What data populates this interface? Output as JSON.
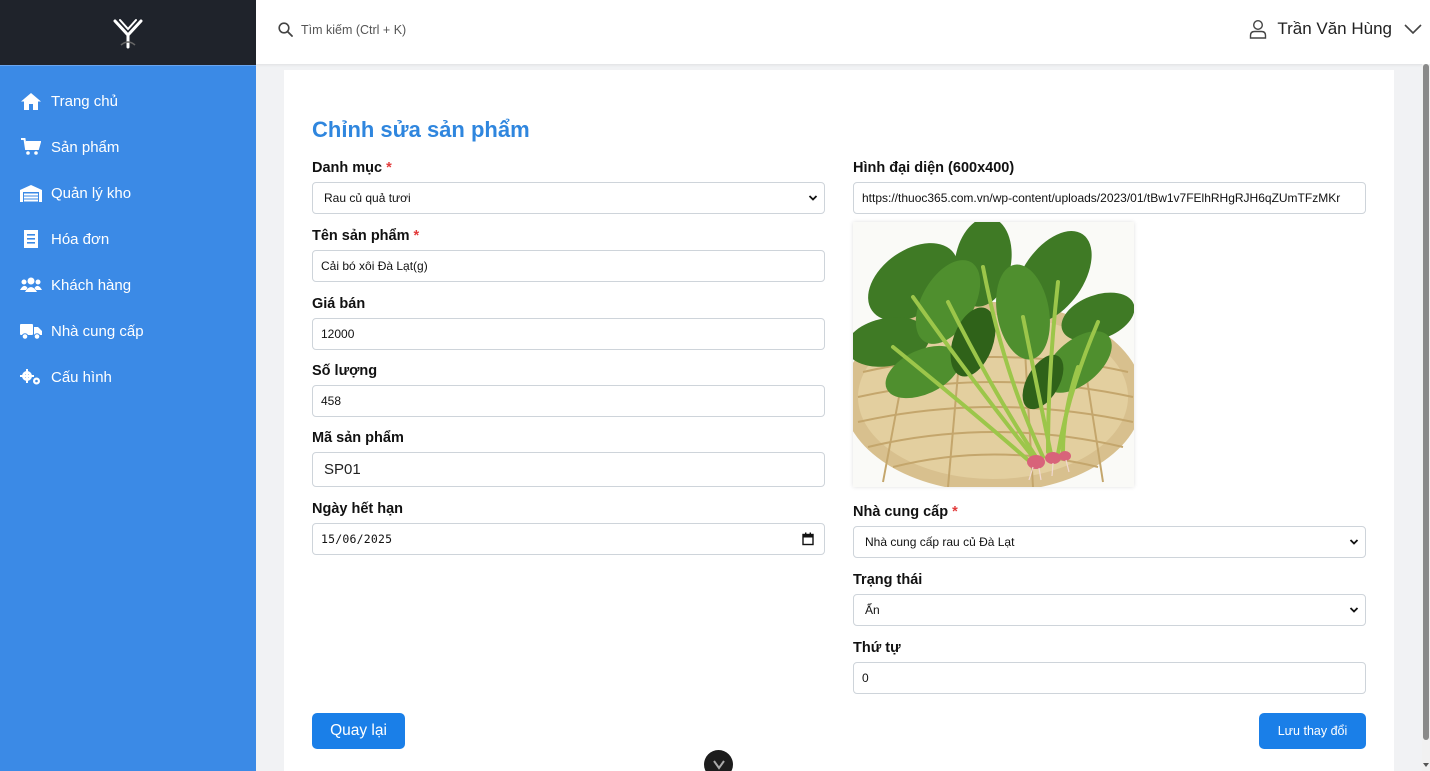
{
  "header": {
    "search_placeholder": "Tìm kiếm (Ctrl + K)",
    "user_name": "Trần Văn Hùng"
  },
  "sidebar": {
    "items": [
      {
        "label": "Trang chủ",
        "icon": "home-icon"
      },
      {
        "label": "Sản phẩm",
        "icon": "cart-icon"
      },
      {
        "label": "Quản lý kho",
        "icon": "warehouse-icon"
      },
      {
        "label": "Hóa đơn",
        "icon": "receipt-icon"
      },
      {
        "label": "Khách hàng",
        "icon": "users-icon"
      },
      {
        "label": "Nhà cung cấp",
        "icon": "truck-icon"
      },
      {
        "label": "Cấu hình",
        "icon": "gears-icon"
      }
    ]
  },
  "form": {
    "title": "Chỉnh sửa sản phẩm",
    "category": {
      "label": "Danh mục",
      "value": "Rau củ quả tươi"
    },
    "name": {
      "label": "Tên sản phẩm",
      "value": "Cải bó xôi Đà Lạt(g)"
    },
    "price": {
      "label": "Giá bán",
      "value": "12000"
    },
    "quantity": {
      "label": "Số lượng",
      "value": "458"
    },
    "code": {
      "label": "Mã sản phẩm",
      "value": "SP01"
    },
    "expiry": {
      "label": "Ngày hết hạn",
      "value": "15/06/2025"
    },
    "image": {
      "label": "Hình đại diện (600x400)",
      "value": "https://thuoc365.com.vn/wp-content/uploads/2023/01/tBw1v7FElhRHgRJH6qZUmTFzMKr"
    },
    "supplier": {
      "label": "Nhà cung cấp",
      "value": "Nhà cung cấp rau củ Đà Lạt"
    },
    "status": {
      "label": "Trạng thái",
      "value": "Ẩn"
    },
    "order": {
      "label": "Thứ tự",
      "value": "0"
    },
    "required_mark": "*",
    "back_label": "Quay lại",
    "save_label": "Lưu thay đổi"
  },
  "colors": {
    "sidebar_bg": "#3b8ae6",
    "logo_bg": "#1f232b",
    "title": "#2f86de",
    "primary_button": "#1a7fe8",
    "required": "#e23b3b"
  }
}
